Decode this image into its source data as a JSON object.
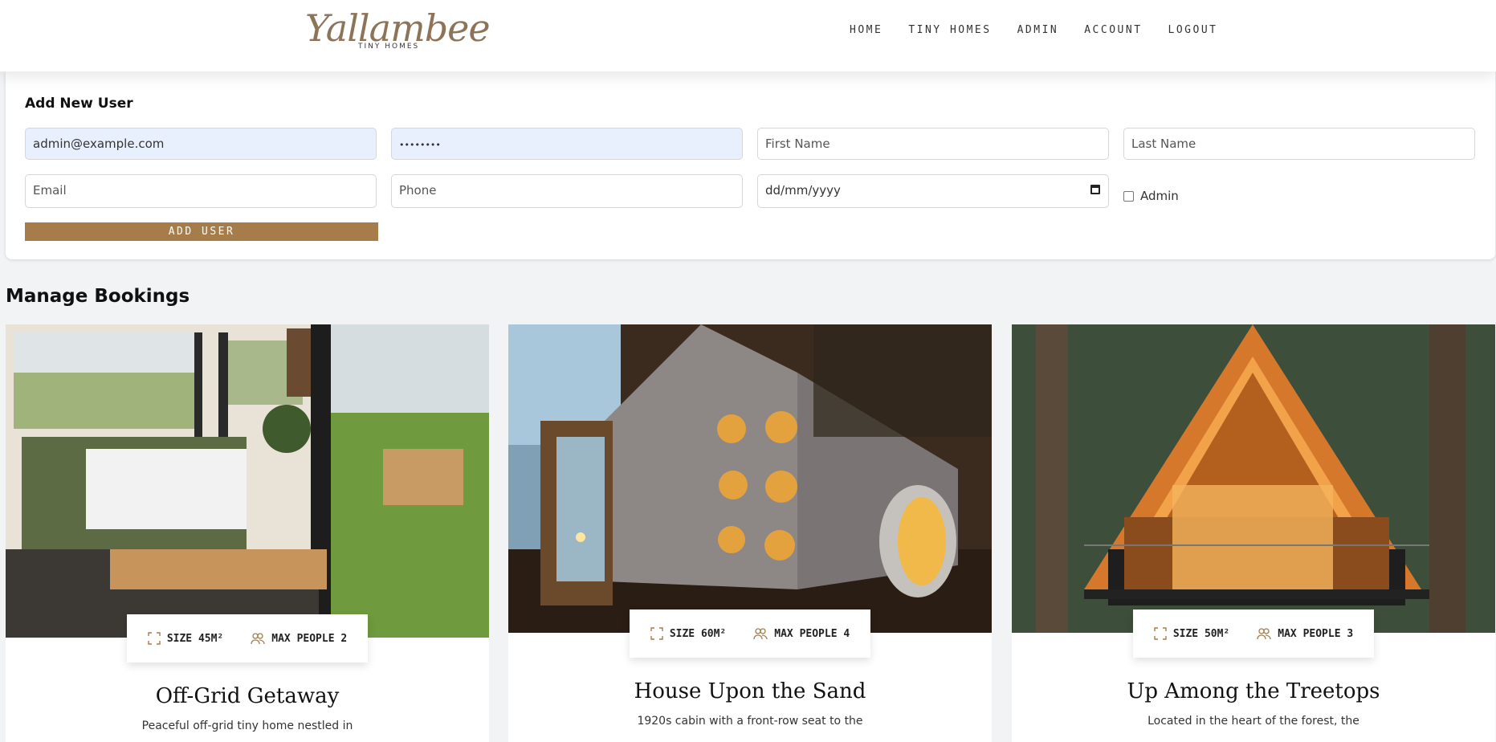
{
  "header": {
    "logo_script": "Yallambee",
    "logo_sub": "TINY HOMES",
    "nav": [
      "HOME",
      "TINY HOMES",
      "ADMIN",
      "ACCOUNT",
      "LOGOUT"
    ]
  },
  "add_user": {
    "title": "Add New User",
    "email_value": "admin@example.com",
    "password_value": "••••••••",
    "first_name_placeholder": "First Name",
    "last_name_placeholder": "Last Name",
    "email_placeholder": "Email",
    "phone_placeholder": "Phone",
    "date_placeholder": "dd/mm/yyyy",
    "admin_label": "Admin",
    "button_label": "ADD USER"
  },
  "bookings": {
    "title": "Manage Bookings",
    "cards": [
      {
        "size": "SIZE 45M²",
        "people": "MAX PEOPLE 2",
        "title": "Off-Grid Getaway",
        "desc": "Peaceful off-grid tiny home nestled in"
      },
      {
        "size": "SIZE 60M²",
        "people": "MAX PEOPLE 4",
        "title": "House Upon the Sand",
        "desc": "1920s cabin with a front-row seat to the"
      },
      {
        "size": "SIZE 50M²",
        "people": "MAX PEOPLE 3",
        "title": "Up Among the Treetops",
        "desc": "Located in the heart of the forest, the"
      }
    ]
  },
  "colors": {
    "accent": "#a67c4a",
    "logo": "#8d7357",
    "autofill": "#e8f0fd"
  }
}
